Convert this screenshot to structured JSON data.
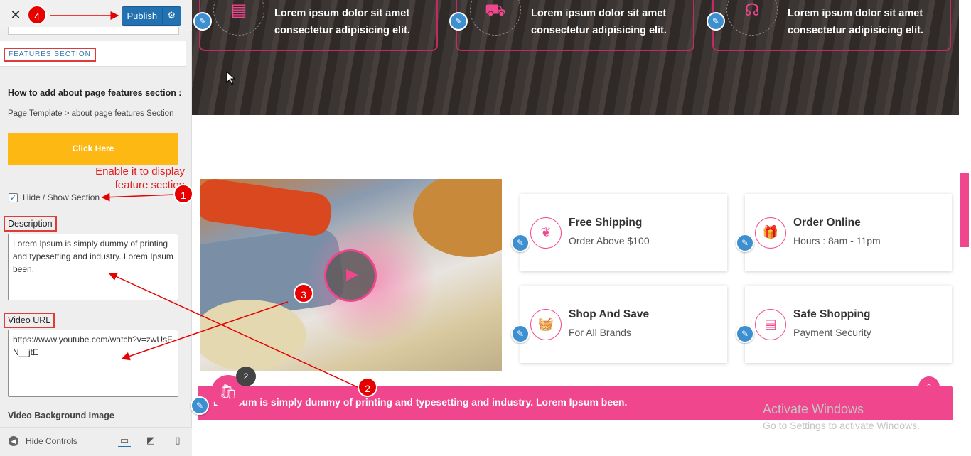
{
  "sidebar": {
    "close_icon": "close-icon",
    "publish_label": "Publish",
    "section_title": "FEATURES SECTION",
    "howto_title": "How to add about page features section :",
    "template_path": "Page Template > about page features Section",
    "click_here_label": "Click Here",
    "annotation_note": "Enable it to display feature section",
    "hide_show_label": "Hide / Show Section",
    "hide_show_checked": true,
    "description_label": "Description",
    "description_value": "Lorem Ipsum is simply dummy of printing and typesetting and industry. Lorem Ipsum been.",
    "video_url_label": "Video URL",
    "video_url_value": "https://www.youtube.com/watch?v=zwUsFN__jtE",
    "video_bg_label": "Video Background Image",
    "hide_controls_label": "Hide Controls"
  },
  "hero": {
    "cards": [
      {
        "icon": "credit-card-icon",
        "text": "Lorem ipsum dolor sit amet consectetur adipisicing elit."
      },
      {
        "icon": "truck-icon",
        "text": "Lorem ipsum dolor sit amet consectetur adipisicing elit."
      },
      {
        "icon": "headphones-icon",
        "text": "Lorem ipsum dolor sit amet consectetur adipisicing elit."
      }
    ]
  },
  "features": [
    {
      "icon": "leaf-icon",
      "title": "Free Shipping",
      "subtitle": "Order Above $100"
    },
    {
      "icon": "gift-icon",
      "title": "Order Online",
      "subtitle": "Hours : 8am - 11pm"
    },
    {
      "icon": "basket-icon",
      "title": "Shop And Save",
      "subtitle": "For All Brands"
    },
    {
      "icon": "credit-card-icon",
      "title": "Safe Shopping",
      "subtitle": "Payment Security"
    }
  ],
  "pink_bar_text": "L    psum is simply dummy of printing and typesetting and industry. Lorem Ipsum been.",
  "cart_count": "2",
  "watermark": {
    "line1": "Activate Windows",
    "line2": "Go to Settings to activate Windows."
  },
  "annotations": [
    "1",
    "2",
    "3",
    "4"
  ],
  "colors": {
    "accent": "#f0468d",
    "publish": "#2271b1",
    "click_here": "#fdb813",
    "annotation_red": "#e60000",
    "edit_blue": "#3d8fd0"
  }
}
